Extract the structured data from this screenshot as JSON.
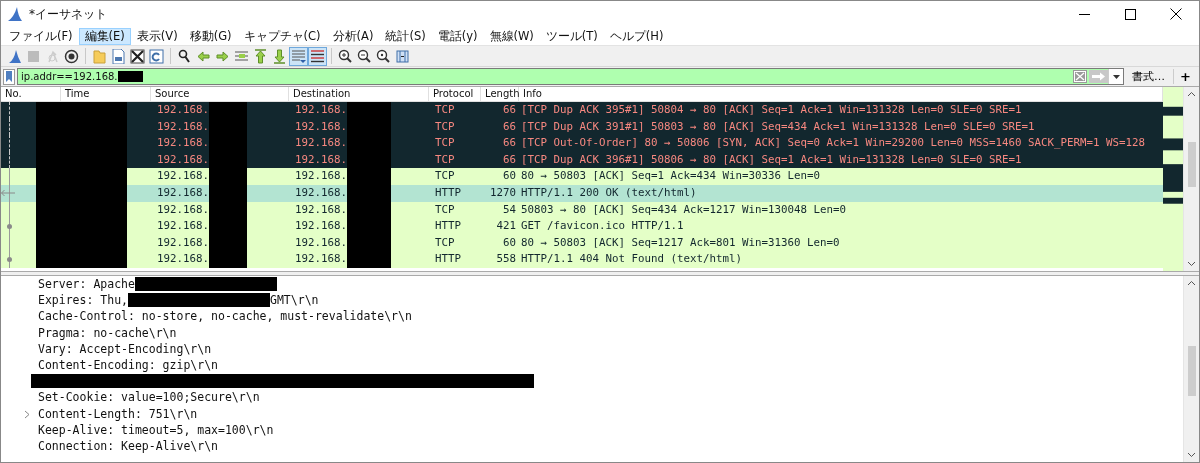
{
  "window": {
    "title": "*イーサネット"
  },
  "menu": [
    {
      "label": "ファイル(F)",
      "selected": false
    },
    {
      "label": "編集(E)",
      "selected": true
    },
    {
      "label": "表示(V)",
      "selected": false
    },
    {
      "label": "移動(G)",
      "selected": false
    },
    {
      "label": "キャプチャ(C)",
      "selected": false
    },
    {
      "label": "分析(A)",
      "selected": false
    },
    {
      "label": "統計(S)",
      "selected": false
    },
    {
      "label": "電話(y)",
      "selected": false
    },
    {
      "label": "無線(W)",
      "selected": false
    },
    {
      "label": "ツール(T)",
      "selected": false
    },
    {
      "label": "ヘルプ(H)",
      "selected": false
    }
  ],
  "toolbar": [
    [
      {
        "disabled": false,
        "on": false
      },
      {
        "disabled": true,
        "on": false
      },
      {
        "disabled": true,
        "on": false
      },
      {
        "disabled": false,
        "on": false
      }
    ],
    [
      {
        "disabled": false,
        "on": false
      },
      {
        "disabled": false,
        "on": false
      },
      {
        "disabled": false,
        "on": false
      },
      {
        "disabled": false,
        "on": false
      }
    ],
    [
      {
        "disabled": false,
        "on": false
      },
      {
        "disabled": false,
        "on": false
      },
      {
        "disabled": false,
        "on": false
      },
      {
        "disabled": false,
        "on": false
      },
      {
        "disabled": false,
        "on": false
      },
      {
        "disabled": false,
        "on": false
      },
      {
        "disabled": false,
        "on": true
      },
      {
        "disabled": false,
        "on": true
      }
    ],
    [
      {
        "disabled": false,
        "on": false
      },
      {
        "disabled": false,
        "on": false
      },
      {
        "disabled": false,
        "on": false
      },
      {
        "disabled": false,
        "on": false
      }
    ]
  ],
  "filter": {
    "value": "ip.addr==192.168.",
    "redacted": true,
    "format_button": "書式…",
    "add_button": "+"
  },
  "packet_list": {
    "columns": [
      {
        "label": "No."
      },
      {
        "label": "Time"
      },
      {
        "label": "Source"
      },
      {
        "label": "Destination"
      },
      {
        "label": "Protocol"
      },
      {
        "label": "Length"
      },
      {
        "label": "Info"
      }
    ],
    "redaction": {
      "time": true,
      "source": true,
      "destination": true
    },
    "rows": [
      {
        "kind": "bad",
        "selected": false,
        "related": false,
        "source": "192.168.",
        "destination": "192.168.",
        "protocol": "TCP",
        "length": "66",
        "info": "[TCP Dup ACK 395#1] 50804 → 80 [ACK] Seq=1 Ack=1 Win=131328 Len=0 SLE=0 SRE=1"
      },
      {
        "kind": "bad",
        "selected": false,
        "related": false,
        "source": "192.168.",
        "destination": "192.168.",
        "protocol": "TCP",
        "length": "66",
        "info": "[TCP Dup ACK 391#1] 50803 → 80 [ACK] Seq=434 Ack=1 Win=131328 Len=0 SLE=0 SRE=1"
      },
      {
        "kind": "bad",
        "selected": false,
        "related": false,
        "source": "192.168.",
        "destination": "192.168.",
        "protocol": "TCP",
        "length": "66",
        "info": "[TCP Out-Of-Order] 80 → 50806 [SYN, ACK] Seq=0 Ack=1 Win=29200 Len=0 MSS=1460 SACK_PERM=1 WS=128"
      },
      {
        "kind": "bad",
        "selected": false,
        "related": false,
        "source": "192.168.",
        "destination": "192.168.",
        "protocol": "TCP",
        "length": "66",
        "info": "[TCP Dup ACK 396#1] 50806 → 80 [ACK] Seq=1 Ack=1 Win=131328 Len=0 SLE=0 SRE=1"
      },
      {
        "kind": "normal",
        "selected": false,
        "related": false,
        "source": "192.168.",
        "destination": "192.168.",
        "protocol": "TCP",
        "length": "60",
        "info": "80 → 50803 [ACK] Seq=1 Ack=434 Win=30336 Len=0"
      },
      {
        "kind": "normal",
        "selected": true,
        "related": false,
        "source": "192.168.",
        "destination": "192.168.",
        "protocol": "HTTP",
        "length": "1270",
        "info": "HTTP/1.1 200 OK  (text/html)"
      },
      {
        "kind": "normal",
        "selected": false,
        "related": false,
        "source": "192.168.",
        "destination": "192.168.",
        "protocol": "TCP",
        "length": "54",
        "info": "50803 → 80 [ACK] Seq=434 Ack=1217 Win=130048 Len=0"
      },
      {
        "kind": "normal",
        "selected": false,
        "related": true,
        "source": "192.168.",
        "destination": "192.168.",
        "protocol": "HTTP",
        "length": "421",
        "info": "GET /favicon.ico HTTP/1.1"
      },
      {
        "kind": "normal",
        "selected": false,
        "related": false,
        "source": "192.168.",
        "destination": "192.168.",
        "protocol": "TCP",
        "length": "60",
        "info": "80 → 50803 [ACK] Seq=1217 Ack=801 Win=31360 Len=0"
      },
      {
        "kind": "normal",
        "selected": false,
        "related": true,
        "source": "192.168.",
        "destination": "192.168.",
        "protocol": "HTTP",
        "length": "558",
        "info": "HTTP/1.1 404 Not Found  (text/html)"
      }
    ]
  },
  "details": [
    {
      "expandable": false,
      "segments": [
        {
          "kind": "text",
          "text": "Server: Apache"
        },
        {
          "kind": "redaction"
        }
      ]
    },
    {
      "expandable": false,
      "segments": [
        {
          "kind": "text",
          "text": "Expires: Thu,"
        },
        {
          "kind": "redaction"
        },
        {
          "kind": "text",
          "text": "GMT\\r\\n"
        }
      ]
    },
    {
      "expandable": false,
      "segments": [
        {
          "kind": "text",
          "text": "Cache-Control: no-store, no-cache, must-revalidate\\r\\n"
        }
      ]
    },
    {
      "expandable": false,
      "segments": [
        {
          "kind": "text",
          "text": "Pragma: no-cache\\r\\n"
        }
      ]
    },
    {
      "expandable": false,
      "segments": [
        {
          "kind": "text",
          "text": "Vary: Accept-Encoding\\r\\n"
        }
      ]
    },
    {
      "expandable": false,
      "segments": [
        {
          "kind": "text",
          "text": "Content-Encoding: gzip\\r\\n"
        }
      ]
    },
    {
      "expandable": false,
      "segments": [
        {
          "kind": "redaction-line"
        }
      ]
    },
    {
      "expandable": false,
      "segments": [
        {
          "kind": "text",
          "text": "Set-Cookie: value=100;Secure\\r\\n"
        }
      ]
    },
    {
      "expandable": true,
      "segments": [
        {
          "kind": "text",
          "text": "Content-Length: 751\\r\\n"
        }
      ]
    },
    {
      "expandable": false,
      "segments": [
        {
          "kind": "text",
          "text": "Keep-Alive: timeout=5, max=100\\r\\n"
        }
      ]
    },
    {
      "expandable": false,
      "segments": [
        {
          "kind": "text",
          "text": "Connection: Keep-Alive\\r\\n"
        }
      ]
    }
  ]
}
